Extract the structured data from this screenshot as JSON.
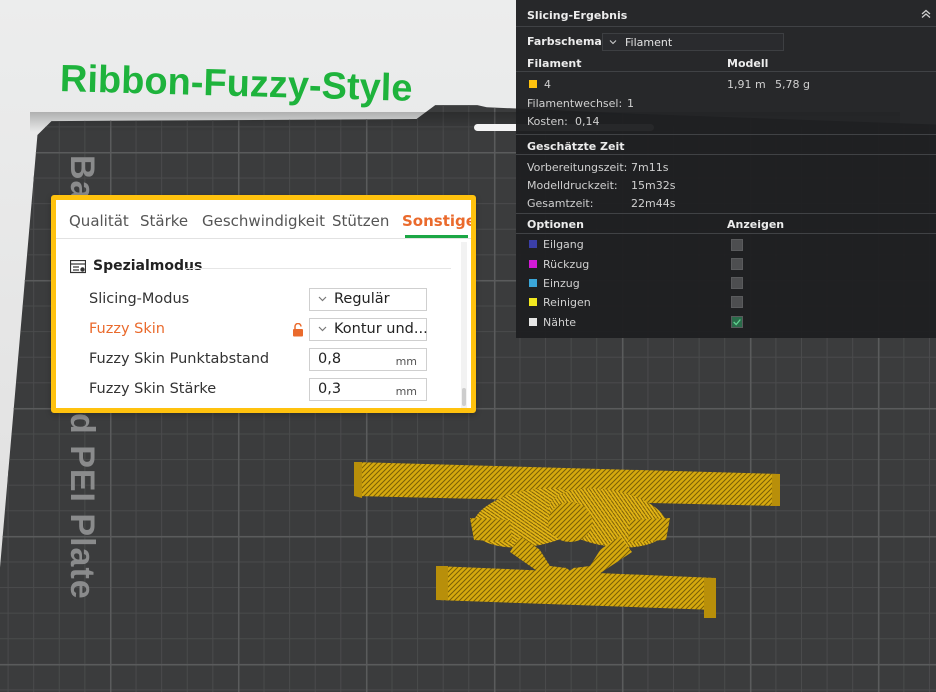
{
  "viewport": {
    "model_title": "Ribbon-Fuzzy-Style",
    "plate_label": "Bambu Textured PEI Plate",
    "colors": {
      "plate": "#3b3c3d",
      "filament": "#d9ad0f",
      "title": "#1eb33c"
    }
  },
  "settings": {
    "tabs": [
      {
        "label": "Qualität",
        "active": false
      },
      {
        "label": "Stärke",
        "active": false
      },
      {
        "label": "Geschwindigkeit",
        "active": false
      },
      {
        "label": "Stützen",
        "active": false
      },
      {
        "label": "Sonstige",
        "active": true
      }
    ],
    "section": {
      "title": "Spezialmodus",
      "icon": "table-settings-icon"
    },
    "rows": [
      {
        "label": "Slicing-Modus",
        "value": "Regulär",
        "type": "select",
        "modified": false
      },
      {
        "label": "Fuzzy Skin",
        "value": "Kontur und...",
        "type": "select",
        "modified": true,
        "icon": "unlocked-icon"
      },
      {
        "label": "Fuzzy Skin Punktabstand",
        "value": "0,8",
        "unit": "mm",
        "type": "number",
        "modified": false
      },
      {
        "label": "Fuzzy Skin Stärke",
        "value": "0,3",
        "unit": "mm",
        "type": "number",
        "modified": false
      }
    ],
    "colors": {
      "accent_orange": "#ea6a2c",
      "tab_underline": "#1ba745",
      "highlight_border": "#ffc20e"
    }
  },
  "slicing_result": {
    "title": "Slicing-Ergebnis",
    "color_scheme_label": "Farbschema",
    "color_scheme_value": "Filament",
    "table_headers": {
      "filament": "Filament",
      "model": "Modell"
    },
    "filament_row": {
      "id": "4",
      "color": "#ffc20e",
      "length": "1,91 m",
      "weight": "5,78 g"
    },
    "filament_change_label": "Filamentwechsel:",
    "filament_change_value": "1",
    "cost_label": "Kosten:",
    "cost_value": "0,14",
    "estimated_time_title": "Geschätzte Zeit",
    "times": [
      {
        "label": "Vorbereitungszeit:",
        "value": "7m11s"
      },
      {
        "label": "Modelldruckzeit:",
        "value": "15m32s"
      },
      {
        "label": "Gesamtzeit:",
        "value": "22m44s"
      }
    ],
    "options_header": "Optionen",
    "display_header": "Anzeigen",
    "options": [
      {
        "label": "Eilgang",
        "color": "#3b3fa8",
        "checked": false
      },
      {
        "label": "Rückzug",
        "color": "#d21ad6",
        "checked": false
      },
      {
        "label": "Einzug",
        "color": "#3ba6d8",
        "checked": false
      },
      {
        "label": "Reinigen",
        "color": "#f2e820",
        "checked": false
      },
      {
        "label": "Nähte",
        "color": "#e6e6e6",
        "checked": true
      }
    ]
  }
}
